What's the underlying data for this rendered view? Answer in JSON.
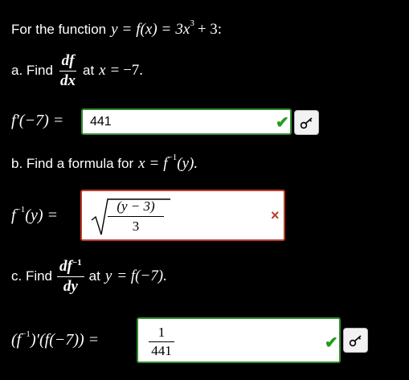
{
  "header": {
    "prefix": "For the function",
    "lhs": "y",
    "eq": "=",
    "func": "f(x)",
    "eq2": "=",
    "coef": "3x",
    "exp": "3",
    "rest": "+ 3:"
  },
  "part_a": {
    "label": "a. Find",
    "frac_num": "df",
    "frac_den": "dx",
    "at_text": "at",
    "var": "x",
    "eq": "= −7.",
    "answer_lhs": "f′(−7) =",
    "answer_value": "441"
  },
  "part_b": {
    "label": "b. Find a formula for",
    "var": "x",
    "eq": "=",
    "f": "f",
    "inv_exp": "−1",
    "arg": "(y).",
    "answer_lhs_f": "f",
    "answer_lhs_exp": "−1",
    "answer_lhs_rest": "(y) =",
    "answer_num": "(y − 3)",
    "answer_den": "3",
    "status_glyph": "×"
  },
  "part_c": {
    "label": "c. Find",
    "frac_num": "df",
    "frac_num_exp": "−1",
    "frac_den": "dy",
    "at_text": "at",
    "var": "y",
    "eq": "= f(−7).",
    "answer_lhs_a": "(f",
    "answer_lhs_exp": "−1",
    "answer_lhs_b": ")′(f(−7)) =",
    "answer_num": "1",
    "answer_den": "441"
  },
  "icons": {
    "correct": "checkmark-icon",
    "incorrect": "x-mark-icon",
    "key": "key-icon"
  },
  "colors": {
    "correct": "#1f9d1f",
    "incorrect": "#c0392b",
    "background": "#000000"
  },
  "status": {
    "check": "✔"
  }
}
